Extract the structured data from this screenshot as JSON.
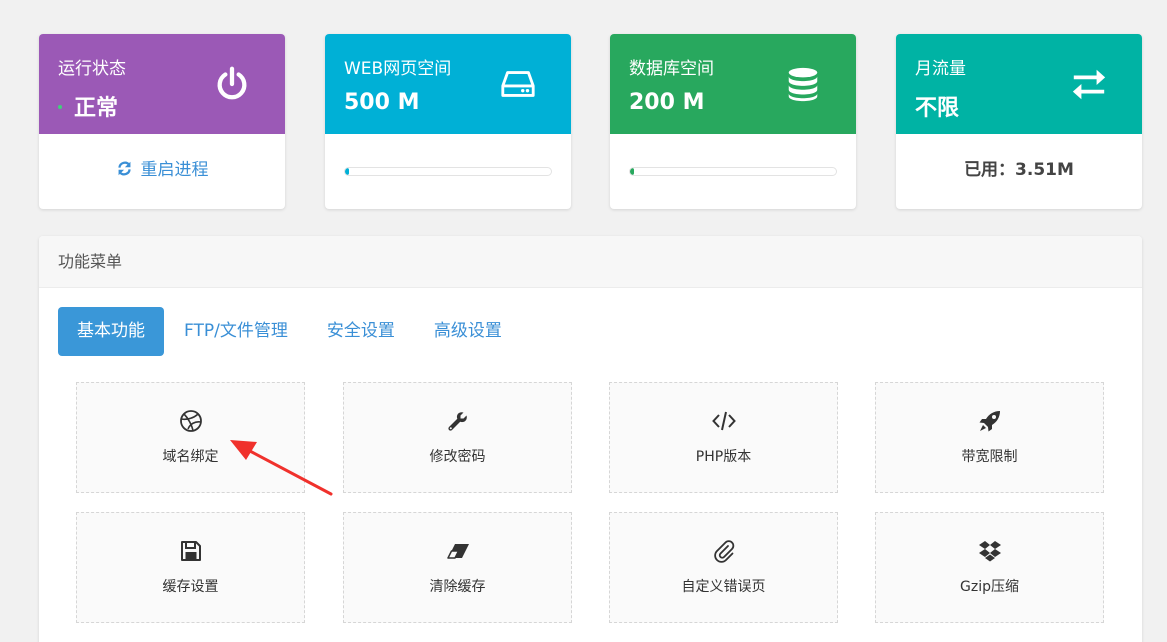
{
  "status_cards": [
    {
      "title": "运行状态",
      "value": "正常",
      "action": "重启进程",
      "color": "#9b59b6"
    },
    {
      "title": "WEB网页空间",
      "value": "500 M",
      "progress": 0.02,
      "color": "#00b0d6"
    },
    {
      "title": "数据库空间",
      "value": "200 M",
      "progress": 0.01,
      "color": "#28a85e"
    },
    {
      "title": "月流量",
      "value": "不限",
      "used": "已用：3.51M",
      "color": "#00b3a4"
    }
  ],
  "panel": {
    "title": "功能菜单",
    "tabs": [
      {
        "label": "基本功能",
        "active": true
      },
      {
        "label": "FTP/文件管理",
        "active": false
      },
      {
        "label": "安全设置",
        "active": false
      },
      {
        "label": "高级设置",
        "active": false
      }
    ],
    "items": [
      {
        "label": "域名绑定",
        "icon": "dribbble-icon"
      },
      {
        "label": "修改密码",
        "icon": "wrench-icon"
      },
      {
        "label": "PHP版本",
        "icon": "code-icon"
      },
      {
        "label": "带宽限制",
        "icon": "rocket-icon"
      },
      {
        "label": "缓存设置",
        "icon": "floppy-disk-icon"
      },
      {
        "label": "清除缓存",
        "icon": "eraser-icon"
      },
      {
        "label": "自定义错误页",
        "icon": "paperclip-icon"
      },
      {
        "label": "Gzip压缩",
        "icon": "dropbox-icon"
      }
    ]
  },
  "annotation": {
    "color": "#f0312c"
  }
}
